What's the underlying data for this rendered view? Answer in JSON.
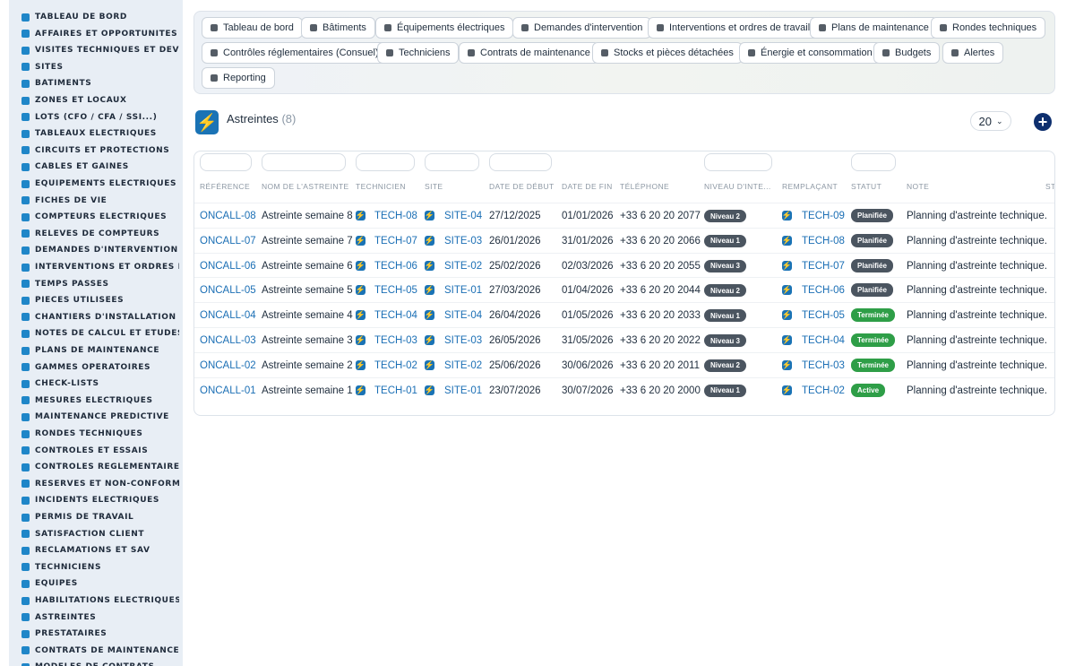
{
  "sidebar": {
    "items": [
      {
        "label": "TABLEAU DE BORD",
        "icon": "dashboard-icon"
      },
      {
        "label": "AFFAIRES ET OPPORTUNITÉS",
        "icon": "target-icon"
      },
      {
        "label": "VISITES TECHNIQUES ET DEVIS",
        "icon": "clipboard-icon"
      },
      {
        "label": "SITES",
        "icon": "location-pin-icon"
      },
      {
        "label": "BÂTIMENTS",
        "icon": "building-icon"
      },
      {
        "label": "ZONES ET LOCAUX",
        "icon": "grid-icon"
      },
      {
        "label": "LOTS (CFO / CFA / SSI...)",
        "icon": "hierarchy-icon"
      },
      {
        "label": "TABLEAUX ÉLECTRIQUES",
        "icon": "panel-icon"
      },
      {
        "label": "CIRCUITS ET PROTECTIONS",
        "icon": "bolt-icon"
      },
      {
        "label": "CÂBLES ET GAINES",
        "icon": "cable-icon"
      },
      {
        "label": "ÉQUIPEMENTS ÉLECTRIQUES",
        "icon": "gears-icon"
      },
      {
        "label": "FICHES DE VIE",
        "icon": "history-icon"
      },
      {
        "label": "COMPTEURS ÉLECTRIQUES",
        "icon": "gauge-icon"
      },
      {
        "label": "RELEVÉS DE COMPTEURS",
        "icon": "reading-icon"
      },
      {
        "label": "DEMANDES D'INTERVENTION",
        "icon": "question-icon"
      },
      {
        "label": "INTERVENTIONS ET ORDRES DE TRAVAIL",
        "icon": "clipboard-check-icon"
      },
      {
        "label": "TEMPS PASSÉS",
        "icon": "clock-icon"
      },
      {
        "label": "PIÈCES UTILISÉES",
        "icon": "box-icon"
      },
      {
        "label": "CHANTIERS D'INSTALLATION",
        "icon": "hammer-icon"
      },
      {
        "label": "NOTES DE CALCUL ET ÉTUDES",
        "icon": "calculator-icon"
      },
      {
        "label": "PLANS DE MAINTENANCE",
        "icon": "calendar-icon"
      },
      {
        "label": "GAMMES OPÉRATOIRES",
        "icon": "list-icon"
      },
      {
        "label": "CHECK-LISTS",
        "icon": "checklist-icon"
      },
      {
        "label": "MESURES ÉLECTRIQUES",
        "icon": "flask-icon"
      },
      {
        "label": "MAINTENANCE PRÉDICTIVE",
        "icon": "chart-icon"
      },
      {
        "label": "RONDES TECHNIQUES",
        "icon": "route-icon"
      },
      {
        "label": "CONTRÔLES ET ESSAIS",
        "icon": "search-icon"
      },
      {
        "label": "CONTRÔLES RÉGLEMENTAIRES",
        "icon": "document-check-icon"
      },
      {
        "label": "RÉSERVES ET NON-CONFORMITÉS",
        "icon": "alert-circle-icon"
      },
      {
        "label": "INCIDENTS ÉLECTRIQUES",
        "icon": "warning-icon"
      },
      {
        "label": "PERMIS DE TRAVAIL",
        "icon": "permit-icon"
      },
      {
        "label": "SATISFACTION CLIENT",
        "icon": "smile-icon"
      },
      {
        "label": "RÉCLAMATIONS ET SAV",
        "icon": "chat-icon"
      },
      {
        "label": "TECHNICIENS",
        "icon": "hardhat-icon"
      },
      {
        "label": "ÉQUIPES",
        "icon": "users-icon"
      },
      {
        "label": "HABILITATIONS ÉLECTRIQUES",
        "icon": "badge-icon"
      },
      {
        "label": "ASTREINTES",
        "icon": "phone-icon"
      },
      {
        "label": "PRESTATAIRES",
        "icon": "handshake-icon"
      },
      {
        "label": "CONTRATS DE MAINTENANCE",
        "icon": "contract-icon"
      },
      {
        "label": "MODÈLES DE CONTRATS",
        "icon": "template-icon"
      }
    ]
  },
  "topnav": {
    "buttons": [
      {
        "label": "Tableau de bord",
        "icon": "dashboard-icon"
      },
      {
        "label": "Bâtiments",
        "icon": "building-icon"
      },
      {
        "label": "Équipements électriques",
        "icon": "gears-icon"
      },
      {
        "label": "Demandes d'intervention",
        "icon": "question-icon"
      },
      {
        "label": "Interventions et ordres de travail",
        "icon": "clipboard-check-icon"
      },
      {
        "label": "Plans de maintenance",
        "icon": "calendar-icon"
      },
      {
        "label": "Rondes techniques",
        "icon": "route-icon"
      },
      {
        "label": "Contrôles réglementaires (Consuel)",
        "icon": "document-check-icon"
      },
      {
        "label": "Techniciens",
        "icon": "hardhat-icon"
      },
      {
        "label": "Contrats de maintenance",
        "icon": "contract-icon"
      },
      {
        "label": "Stocks et pièces détachées",
        "icon": "boxes-icon"
      },
      {
        "label": "Énergie et consommation",
        "icon": "bolt-icon"
      },
      {
        "label": "Budgets",
        "icon": "money-icon"
      },
      {
        "label": "Alertes",
        "icon": "bell-icon"
      },
      {
        "label": "Reporting",
        "icon": "pie-chart-icon"
      }
    ]
  },
  "header": {
    "logo_icon": "lightning-icon",
    "title": "Astreintes",
    "count": "(8)",
    "per_page": "20",
    "add_icon": "plus-circle-icon"
  },
  "table": {
    "columns": [
      "RÉFÉRENCE",
      "NOM DE L'ASTREINTE",
      "TECHNICIEN",
      "SITE",
      "DATE DE DÉBUT",
      "DATE DE FIN",
      "TÉLÉPHONE",
      "NIVEAU D'INTE...",
      "REMPLAÇANT",
      "STATUT",
      "NOTE",
      "ST"
    ],
    "rows": [
      {
        "ref": "ONCALL-08",
        "name": "Astreinte semaine 8",
        "tech": "TECH-08",
        "site": "SITE-04",
        "start": "27/12/2025",
        "end": "01/01/2026",
        "phone": "+33 6 20 20 2077",
        "level": "Niveau 2",
        "replacement": "TECH-09",
        "status": "Planifiée",
        "note": "Planning d'astreinte technique."
      },
      {
        "ref": "ONCALL-07",
        "name": "Astreinte semaine 7",
        "tech": "TECH-07",
        "site": "SITE-03",
        "start": "26/01/2026",
        "end": "31/01/2026",
        "phone": "+33 6 20 20 2066",
        "level": "Niveau 1",
        "replacement": "TECH-08",
        "status": "Planifiée",
        "note": "Planning d'astreinte technique."
      },
      {
        "ref": "ONCALL-06",
        "name": "Astreinte semaine 6",
        "tech": "TECH-06",
        "site": "SITE-02",
        "start": "25/02/2026",
        "end": "02/03/2026",
        "phone": "+33 6 20 20 2055",
        "level": "Niveau 3",
        "replacement": "TECH-07",
        "status": "Planifiée",
        "note": "Planning d'astreinte technique."
      },
      {
        "ref": "ONCALL-05",
        "name": "Astreinte semaine 5",
        "tech": "TECH-05",
        "site": "SITE-01",
        "start": "27/03/2026",
        "end": "01/04/2026",
        "phone": "+33 6 20 20 2044",
        "level": "Niveau 2",
        "replacement": "TECH-06",
        "status": "Planifiée",
        "note": "Planning d'astreinte technique."
      },
      {
        "ref": "ONCALL-04",
        "name": "Astreinte semaine 4",
        "tech": "TECH-04",
        "site": "SITE-04",
        "start": "26/04/2026",
        "end": "01/05/2026",
        "phone": "+33 6 20 20 2033",
        "level": "Niveau 1",
        "replacement": "TECH-05",
        "status": "Terminée",
        "note": "Planning d'astreinte technique."
      },
      {
        "ref": "ONCALL-03",
        "name": "Astreinte semaine 3",
        "tech": "TECH-03",
        "site": "SITE-03",
        "start": "26/05/2026",
        "end": "31/05/2026",
        "phone": "+33 6 20 20 2022",
        "level": "Niveau 3",
        "replacement": "TECH-04",
        "status": "Terminée",
        "note": "Planning d'astreinte technique."
      },
      {
        "ref": "ONCALL-02",
        "name": "Astreinte semaine 2",
        "tech": "TECH-02",
        "site": "SITE-02",
        "start": "25/06/2026",
        "end": "30/06/2026",
        "phone": "+33 6 20 20 2011",
        "level": "Niveau 2",
        "replacement": "TECH-03",
        "status": "Terminée",
        "note": "Planning d'astreinte technique."
      },
      {
        "ref": "ONCALL-01",
        "name": "Astreinte semaine 1",
        "tech": "TECH-01",
        "site": "SITE-01",
        "start": "23/07/2026",
        "end": "30/07/2026",
        "phone": "+33 6 20 20 2000",
        "level": "Niveau 1",
        "replacement": "TECH-02",
        "status": "Active",
        "note": "Planning d'astreinte technique."
      }
    ]
  },
  "colors": {
    "link": "#1b6fb5",
    "status_planned": "#4b5560",
    "status_done": "#2e9e47",
    "status_active": "#2e9e47",
    "level_badge": "#4b5560",
    "sidebar_icon": "#1f86c8",
    "add_button": "#0e2f6e"
  }
}
